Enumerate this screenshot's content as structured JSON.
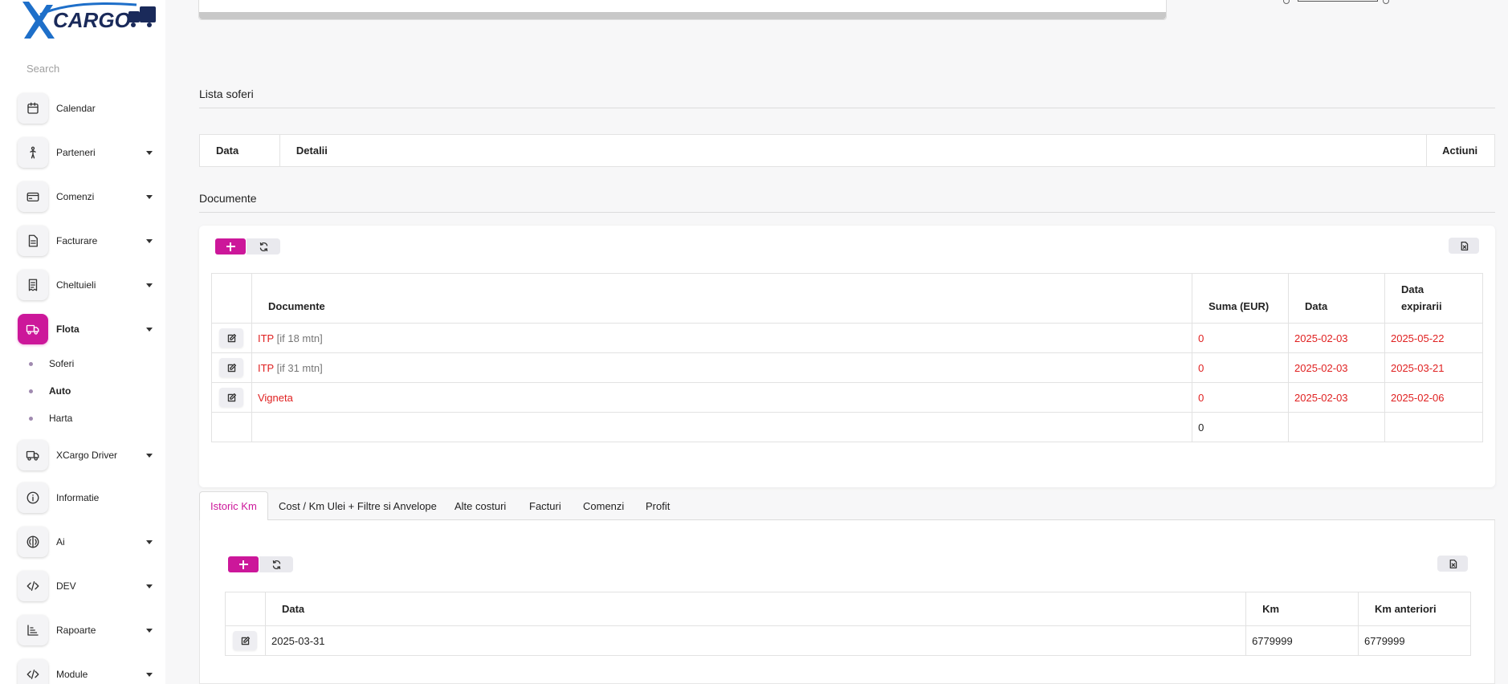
{
  "brand": {
    "logo_text": "CARGO",
    "accent": "#cc179a"
  },
  "sidebar": {
    "search_placeholder": "Search",
    "items": [
      {
        "label": "Calendar",
        "icon": "calendar-icon"
      },
      {
        "label": "Parteneri",
        "icon": "person-icon",
        "has_caret": true
      },
      {
        "label": "Comenzi",
        "icon": "credit-card-icon",
        "has_caret": true
      },
      {
        "label": "Facturare",
        "icon": "document-icon",
        "has_caret": true
      },
      {
        "label": "Cheltuieli",
        "icon": "receipt-icon",
        "has_caret": true
      },
      {
        "label": "Flota",
        "icon": "truck-icon",
        "has_caret": true,
        "active": true
      },
      {
        "label": "XCargo Driver",
        "icon": "truck-icon",
        "has_caret": true
      },
      {
        "label": "Informatie",
        "icon": "info-icon"
      },
      {
        "label": "Ai",
        "icon": "brain-icon",
        "has_caret": true
      },
      {
        "label": "DEV",
        "icon": "code-icon",
        "has_caret": true
      },
      {
        "label": "Rapoarte",
        "icon": "bar-chart-icon",
        "has_caret": true
      },
      {
        "label": "Module",
        "icon": "code-icon",
        "has_caret": true
      }
    ],
    "flota_sub": [
      {
        "label": "Soferi"
      },
      {
        "label": "Auto",
        "active": true
      },
      {
        "label": "Harta"
      }
    ]
  },
  "lista_soferi": {
    "title": "Lista soferi",
    "columns": [
      "Data",
      "Detalii",
      "Actiuni"
    ]
  },
  "documente": {
    "title": "Documente",
    "columns": [
      "Documente",
      "Suma (EUR)",
      "Data",
      "Data expirarii"
    ],
    "rows": [
      {
        "name": "ITP",
        "note": "[if 18 mtn]",
        "suma": "0",
        "data": "2025-02-03",
        "expirare": "2025-05-22"
      },
      {
        "name": "ITP",
        "note": "[if 31 mtn]",
        "suma": "0",
        "data": "2025-02-03",
        "expirare": "2025-03-21"
      },
      {
        "name": "Vigneta",
        "note": "",
        "suma": "0",
        "data": "2025-02-03",
        "expirare": "2025-02-06"
      }
    ],
    "total_suma": "0"
  },
  "tabs": [
    {
      "label": "Istoric Km",
      "active": true
    },
    {
      "label": "Cost / Km Ulei + Filtre si Anvelope"
    },
    {
      "label": "Alte costuri"
    },
    {
      "label": "Facturi"
    },
    {
      "label": "Comenzi"
    },
    {
      "label": "Profit"
    }
  ],
  "istoric_km": {
    "columns": [
      "Data",
      "Km",
      "Km anteriori"
    ],
    "rows": [
      {
        "data": "2025-03-31",
        "km": "6779999",
        "km_anteriori": "6779999"
      }
    ]
  }
}
